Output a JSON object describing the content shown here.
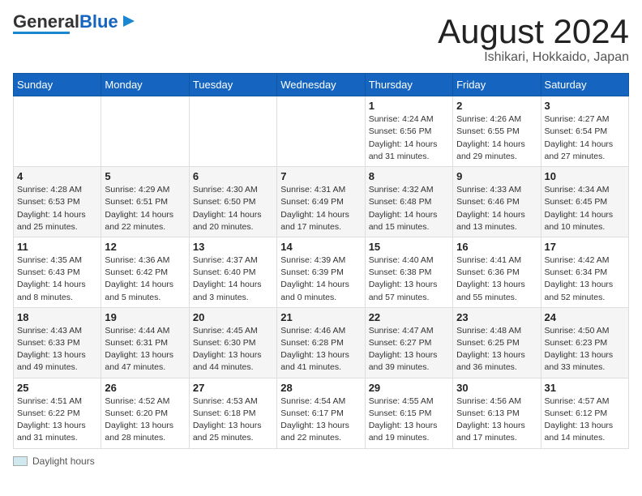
{
  "header": {
    "logo_general": "General",
    "logo_blue": "Blue",
    "month_title": "August 2024",
    "location": "Ishikari, Hokkaido, Japan"
  },
  "legend": {
    "label": "Daylight hours"
  },
  "weekdays": [
    "Sunday",
    "Monday",
    "Tuesday",
    "Wednesday",
    "Thursday",
    "Friday",
    "Saturday"
  ],
  "weeks": [
    [
      {
        "day": "",
        "info": ""
      },
      {
        "day": "",
        "info": ""
      },
      {
        "day": "",
        "info": ""
      },
      {
        "day": "",
        "info": ""
      },
      {
        "day": "1",
        "info": "Sunrise: 4:24 AM\nSunset: 6:56 PM\nDaylight: 14 hours\nand 31 minutes."
      },
      {
        "day": "2",
        "info": "Sunrise: 4:26 AM\nSunset: 6:55 PM\nDaylight: 14 hours\nand 29 minutes."
      },
      {
        "day": "3",
        "info": "Sunrise: 4:27 AM\nSunset: 6:54 PM\nDaylight: 14 hours\nand 27 minutes."
      }
    ],
    [
      {
        "day": "4",
        "info": "Sunrise: 4:28 AM\nSunset: 6:53 PM\nDaylight: 14 hours\nand 25 minutes."
      },
      {
        "day": "5",
        "info": "Sunrise: 4:29 AM\nSunset: 6:51 PM\nDaylight: 14 hours\nand 22 minutes."
      },
      {
        "day": "6",
        "info": "Sunrise: 4:30 AM\nSunset: 6:50 PM\nDaylight: 14 hours\nand 20 minutes."
      },
      {
        "day": "7",
        "info": "Sunrise: 4:31 AM\nSunset: 6:49 PM\nDaylight: 14 hours\nand 17 minutes."
      },
      {
        "day": "8",
        "info": "Sunrise: 4:32 AM\nSunset: 6:48 PM\nDaylight: 14 hours\nand 15 minutes."
      },
      {
        "day": "9",
        "info": "Sunrise: 4:33 AM\nSunset: 6:46 PM\nDaylight: 14 hours\nand 13 minutes."
      },
      {
        "day": "10",
        "info": "Sunrise: 4:34 AM\nSunset: 6:45 PM\nDaylight: 14 hours\nand 10 minutes."
      }
    ],
    [
      {
        "day": "11",
        "info": "Sunrise: 4:35 AM\nSunset: 6:43 PM\nDaylight: 14 hours\nand 8 minutes."
      },
      {
        "day": "12",
        "info": "Sunrise: 4:36 AM\nSunset: 6:42 PM\nDaylight: 14 hours\nand 5 minutes."
      },
      {
        "day": "13",
        "info": "Sunrise: 4:37 AM\nSunset: 6:40 PM\nDaylight: 14 hours\nand 3 minutes."
      },
      {
        "day": "14",
        "info": "Sunrise: 4:39 AM\nSunset: 6:39 PM\nDaylight: 14 hours\nand 0 minutes."
      },
      {
        "day": "15",
        "info": "Sunrise: 4:40 AM\nSunset: 6:38 PM\nDaylight: 13 hours\nand 57 minutes."
      },
      {
        "day": "16",
        "info": "Sunrise: 4:41 AM\nSunset: 6:36 PM\nDaylight: 13 hours\nand 55 minutes."
      },
      {
        "day": "17",
        "info": "Sunrise: 4:42 AM\nSunset: 6:34 PM\nDaylight: 13 hours\nand 52 minutes."
      }
    ],
    [
      {
        "day": "18",
        "info": "Sunrise: 4:43 AM\nSunset: 6:33 PM\nDaylight: 13 hours\nand 49 minutes."
      },
      {
        "day": "19",
        "info": "Sunrise: 4:44 AM\nSunset: 6:31 PM\nDaylight: 13 hours\nand 47 minutes."
      },
      {
        "day": "20",
        "info": "Sunrise: 4:45 AM\nSunset: 6:30 PM\nDaylight: 13 hours\nand 44 minutes."
      },
      {
        "day": "21",
        "info": "Sunrise: 4:46 AM\nSunset: 6:28 PM\nDaylight: 13 hours\nand 41 minutes."
      },
      {
        "day": "22",
        "info": "Sunrise: 4:47 AM\nSunset: 6:27 PM\nDaylight: 13 hours\nand 39 minutes."
      },
      {
        "day": "23",
        "info": "Sunrise: 4:48 AM\nSunset: 6:25 PM\nDaylight: 13 hours\nand 36 minutes."
      },
      {
        "day": "24",
        "info": "Sunrise: 4:50 AM\nSunset: 6:23 PM\nDaylight: 13 hours\nand 33 minutes."
      }
    ],
    [
      {
        "day": "25",
        "info": "Sunrise: 4:51 AM\nSunset: 6:22 PM\nDaylight: 13 hours\nand 31 minutes."
      },
      {
        "day": "26",
        "info": "Sunrise: 4:52 AM\nSunset: 6:20 PM\nDaylight: 13 hours\nand 28 minutes."
      },
      {
        "day": "27",
        "info": "Sunrise: 4:53 AM\nSunset: 6:18 PM\nDaylight: 13 hours\nand 25 minutes."
      },
      {
        "day": "28",
        "info": "Sunrise: 4:54 AM\nSunset: 6:17 PM\nDaylight: 13 hours\nand 22 minutes."
      },
      {
        "day": "29",
        "info": "Sunrise: 4:55 AM\nSunset: 6:15 PM\nDaylight: 13 hours\nand 19 minutes."
      },
      {
        "day": "30",
        "info": "Sunrise: 4:56 AM\nSunset: 6:13 PM\nDaylight: 13 hours\nand 17 minutes."
      },
      {
        "day": "31",
        "info": "Sunrise: 4:57 AM\nSunset: 6:12 PM\nDaylight: 13 hours\nand 14 minutes."
      }
    ]
  ]
}
